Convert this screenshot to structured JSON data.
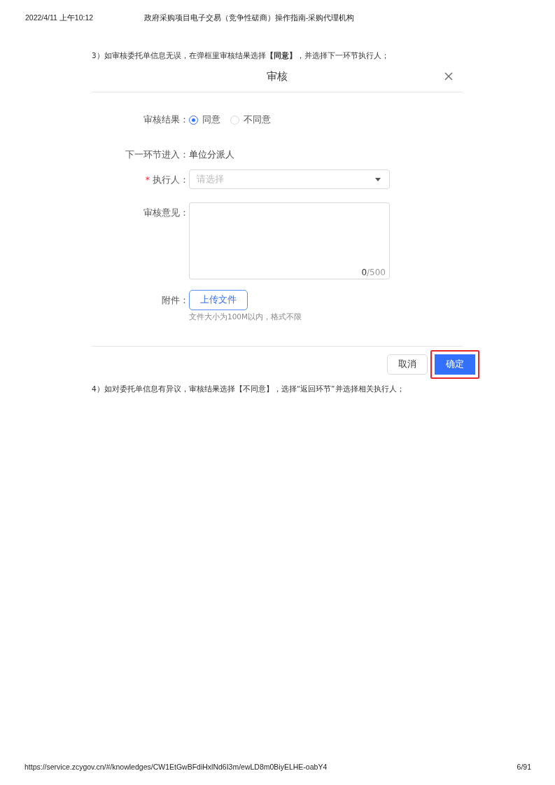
{
  "header": {
    "datetime": "2022/4/11 上午10:12",
    "title": "政府采购项目电子交易（竞争性磋商）操作指南-采购代理机构"
  },
  "step_before": "3）如审核委托单信息无误，在弹框里审核结果选择**【同意】**，并选择下一环节执行人；",
  "dialog": {
    "title": "审核",
    "result": {
      "label": "审核结果：",
      "options": [
        {
          "label": "同意",
          "selected": true
        },
        {
          "label": "不同意",
          "selected": false
        }
      ]
    },
    "next": {
      "label": "下一环节进入：",
      "value": "单位分派人"
    },
    "executor": {
      "label": "执行人：",
      "required_mark": "*",
      "placeholder": "请选择"
    },
    "comment": {
      "label": "审核意见：",
      "count": "0",
      "limit": "/500"
    },
    "attachment": {
      "label": "附件：",
      "button": "上传文件",
      "hint": "文件大小为100M以内，格式不限"
    },
    "buttons": [
      {
        "kind": "secondary",
        "label": "取消",
        "highlighted": false
      },
      {
        "kind": "primary",
        "label": "确定",
        "highlighted": true
      }
    ]
  },
  "step_after": "4）如对委托单信息有异议，审核结果选择【不同意】，选择“返回环节”并选择相关执行人；",
  "footer": {
    "url": "https://service.zcygov.cn/#/knowledges/CW1EtGwBFdiHxlNd6I3m/ewLD8m0BiyELHE-oabY4",
    "page": "6/91"
  }
}
